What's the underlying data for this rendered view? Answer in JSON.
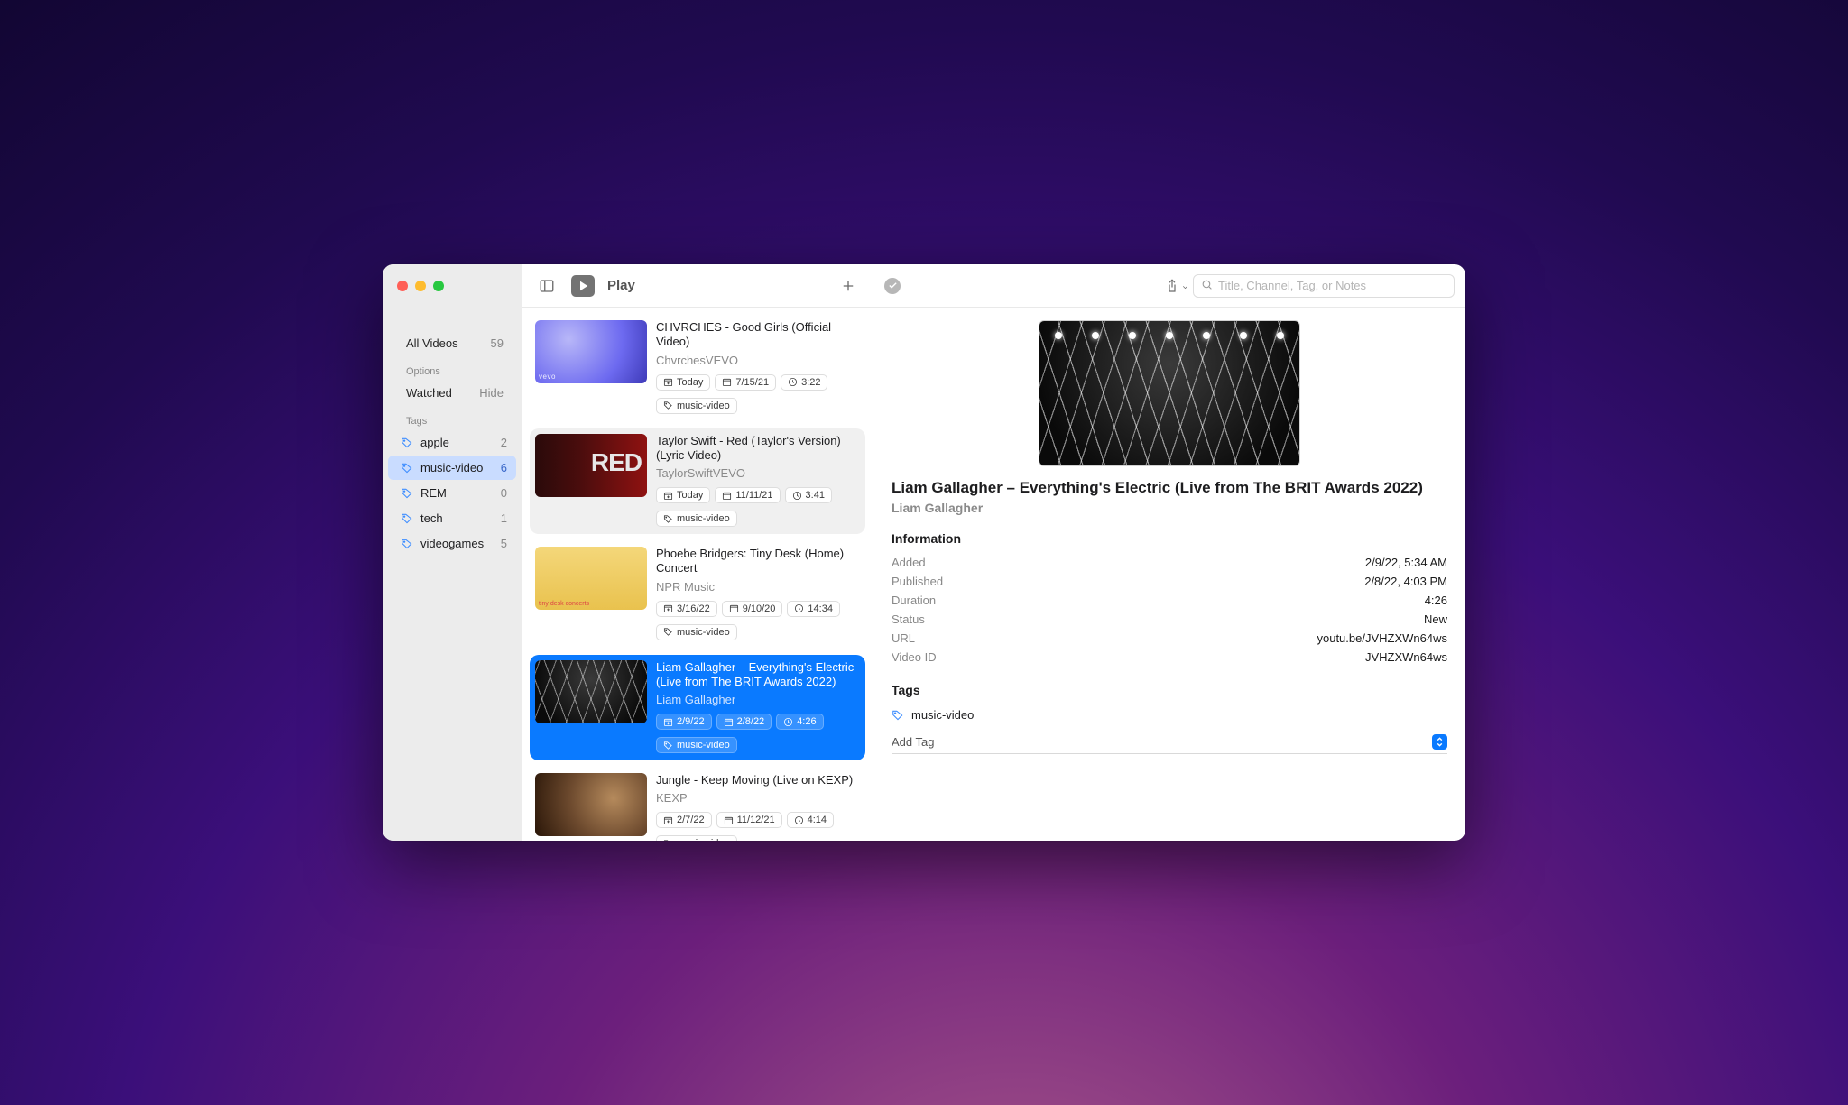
{
  "app": {
    "title": "Play"
  },
  "sidebar": {
    "allVideosLabel": "All Videos",
    "allVideosCount": "59",
    "optionsHeader": "Options",
    "watchedLabel": "Watched",
    "watchedAction": "Hide",
    "tagsHeader": "Tags",
    "tags": [
      {
        "name": "apple",
        "count": "2"
      },
      {
        "name": "music-video",
        "count": "6"
      },
      {
        "name": "REM",
        "count": "0"
      },
      {
        "name": "tech",
        "count": "1"
      },
      {
        "name": "videogames",
        "count": "5"
      }
    ],
    "selectedIndex": 1
  },
  "list": {
    "selectedIndex": 3,
    "items": [
      {
        "title": "CHVRCHES - Good Girls (Official Video)",
        "channel": "ChvrchesVEVO",
        "added": "Today",
        "published": "7/15/21",
        "duration": "3:22",
        "tags": [
          "music-video"
        ]
      },
      {
        "title": "Taylor Swift - Red (Taylor's Version) (Lyric Video)",
        "channel": "TaylorSwiftVEVO",
        "added": "Today",
        "published": "11/11/21",
        "duration": "3:41",
        "tags": [
          "music-video"
        ]
      },
      {
        "title": "Phoebe Bridgers: Tiny Desk (Home) Concert",
        "channel": "NPR Music",
        "added": "3/16/22",
        "published": "9/10/20",
        "duration": "14:34",
        "tags": [
          "music-video"
        ]
      },
      {
        "title": "Liam Gallagher – Everything's Electric (Live from The BRIT Awards 2022)",
        "channel": "Liam Gallagher",
        "added": "2/9/22",
        "published": "2/8/22",
        "duration": "4:26",
        "tags": [
          "music-video"
        ]
      },
      {
        "title": "Jungle - Keep Moving (Live on KEXP)",
        "channel": "KEXP",
        "added": "2/7/22",
        "published": "11/12/21",
        "duration": "4:14",
        "tags": [
          "music-video"
        ]
      }
    ]
  },
  "detail": {
    "title": "Liam Gallagher – Everything's Electric (Live from The BRIT Awards 2022)",
    "channel": "Liam Gallagher",
    "sectionInfo": "Information",
    "info": {
      "addedLabel": "Added",
      "addedVal": "2/9/22, 5:34 AM",
      "publishedLabel": "Published",
      "publishedVal": "2/8/22, 4:03 PM",
      "durationLabel": "Duration",
      "durationVal": "4:26",
      "statusLabel": "Status",
      "statusVal": "New",
      "urlLabel": "URL",
      "urlVal": "youtu.be/JVHZXWn64ws",
      "videoIdLabel": "Video ID",
      "videoIdVal": "JVHZXWn64ws"
    },
    "sectionTags": "Tags",
    "tags": [
      "music-video"
    ],
    "addTagPlaceholder": "Add Tag"
  },
  "search": {
    "placeholder": "Title, Channel, Tag, or Notes"
  }
}
